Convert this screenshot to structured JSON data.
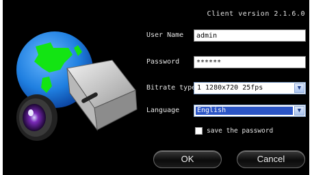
{
  "header": {
    "version": "Client version 2.1.6.0"
  },
  "form": {
    "username_label": "User Name",
    "username_value": "admin",
    "password_label": "Password",
    "password_value": "******",
    "bitrate_label": "Bitrate type",
    "bitrate_value": "1 1280x720 25fps",
    "language_label": "Language",
    "language_value": "English",
    "save_password_label": "save the password"
  },
  "buttons": {
    "ok": "OK",
    "cancel": "Cancel"
  },
  "icons": {
    "dropdown": "chevron-down-icon",
    "logo": "camera-globe-icon"
  },
  "colors": {
    "background": "#000000",
    "text": "#e6e6e6",
    "selection": "#2b55c6",
    "globe": "#1f7fe0",
    "land": "#13e413"
  }
}
